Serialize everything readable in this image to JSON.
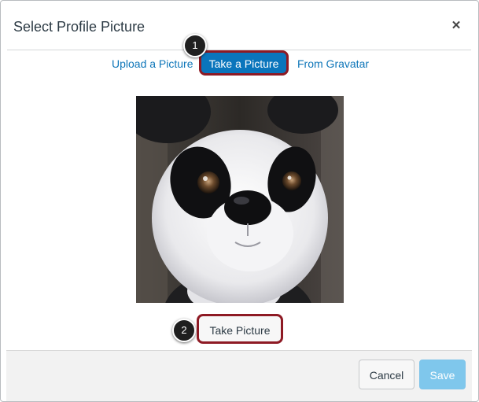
{
  "dialog": {
    "title": "Select Profile Picture",
    "close_icon": "close-icon",
    "close_glyph": "✕"
  },
  "tabs": {
    "upload_label": "Upload a Picture",
    "take_label": "Take a Picture",
    "gravatar_label": "From Gravatar",
    "active": "Take a Picture"
  },
  "callouts": {
    "one": "1",
    "two": "2"
  },
  "camera": {
    "take_picture_label": "Take Picture"
  },
  "footer": {
    "cancel_label": "Cancel",
    "save_label": "Save"
  },
  "colors": {
    "link": "#0e76b9",
    "active_tab": "#0a75bc",
    "highlight_border": "#8e1a24",
    "save_disabled": "#7fc7ec"
  }
}
